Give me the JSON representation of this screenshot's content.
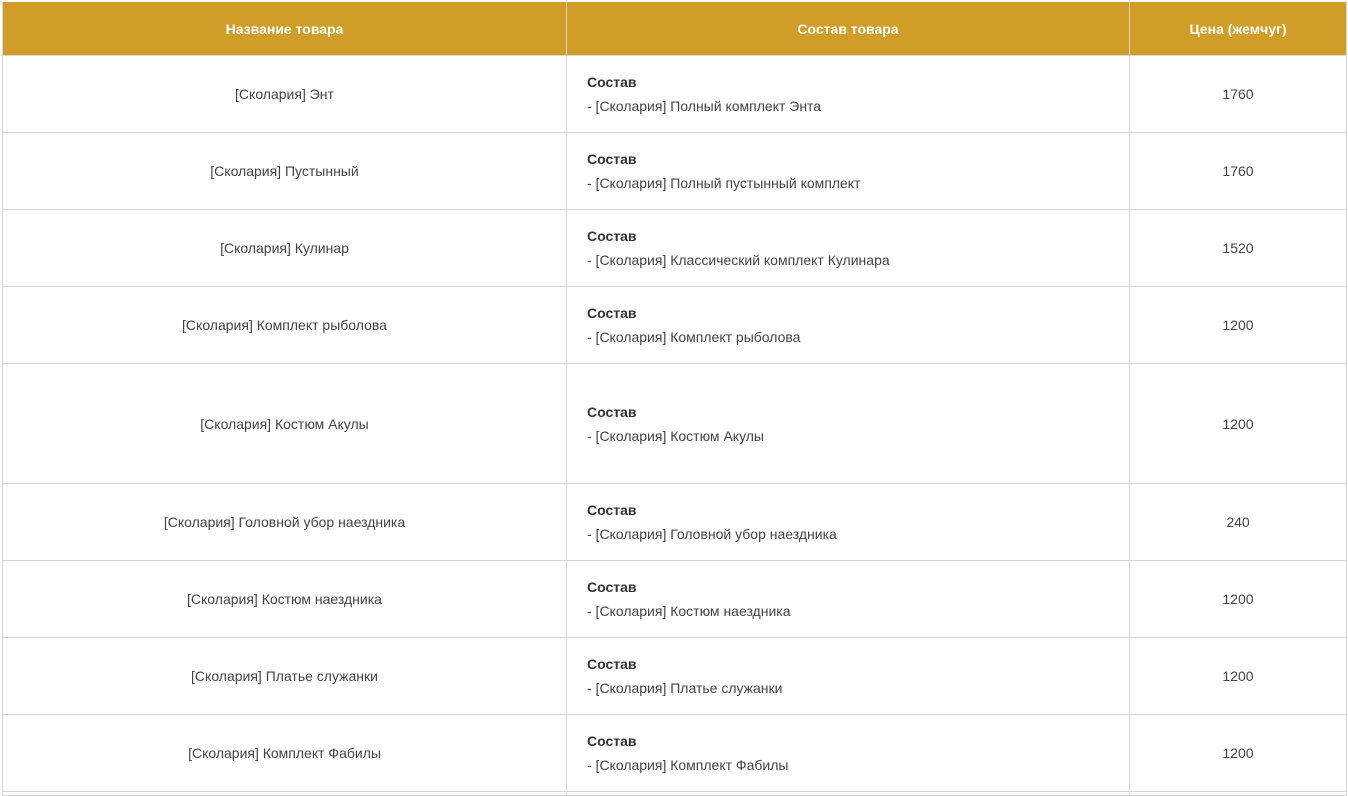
{
  "table": {
    "headers": {
      "name": "Название товара",
      "composition": "Состав товара",
      "price": "Цена (жемчуг)"
    },
    "rows": [
      {
        "name": "[Сколария] Энт",
        "composition_title": "Состав",
        "composition_item": "- [Сколария] Полный комплект Энта",
        "price": "1760"
      },
      {
        "name": "[Сколария] Пустынный",
        "composition_title": "Состав",
        "composition_item": "- [Сколария] Полный пустынный комплект",
        "price": "1760"
      },
      {
        "name": "[Сколария] Кулинар",
        "composition_title": "Состав",
        "composition_item": "- [Сколария] Классический комплект Кулинара",
        "price": "1520"
      },
      {
        "name": "[Сколария] Комплект рыболова",
        "composition_title": "Состав",
        "composition_item": "- [Сколария] Комплект рыболова",
        "price": "1200"
      },
      {
        "name": "[Сколария] Костюм Акулы",
        "composition_title": "Состав",
        "composition_item": "- [Сколария] Костюм Акулы",
        "price": "1200"
      },
      {
        "name": "[Сколария] Головной убор наездника",
        "composition_title": "Состав",
        "composition_item": "- [Сколария] Головной убор наездника",
        "price": "240"
      },
      {
        "name": "[Сколария] Костюм наездника",
        "composition_title": "Состав",
        "composition_item": "- [Сколария] Костюм наездника",
        "price": "1200"
      },
      {
        "name": "[Сколария] Платье служанки",
        "composition_title": "Состав",
        "composition_item": "- [Сколария] Платье служанки",
        "price": "1200"
      },
      {
        "name": "[Сколария] Комплект Фабилы",
        "composition_title": "Состав",
        "composition_item": "- [Сколария] Комплект Фабилы",
        "price": "1200"
      }
    ]
  },
  "colors": {
    "header_background": "#cf9d28",
    "header_text": "#ffffff",
    "border": "#d4d4d4",
    "body_text": "#444444"
  }
}
